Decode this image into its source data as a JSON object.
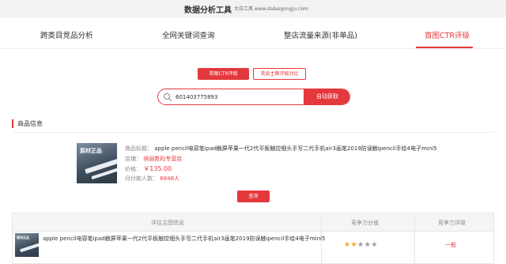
{
  "topbar": {
    "title": "数据分析工具",
    "brand": "大白工具 www.dabaigongju.com"
  },
  "nav": {
    "tabs": [
      {
        "label": "跨类目竞品分析",
        "active": false
      },
      {
        "label": "全网关键词查询",
        "active": false
      },
      {
        "label": "整店流量来源(非单品)",
        "active": false
      },
      {
        "label": "首图CTR评级",
        "active": true
      }
    ]
  },
  "mode_buttons": {
    "primary": "首图CTR评级",
    "secondary": "竞品主图评级对比"
  },
  "search": {
    "value": "601403775893",
    "button": "自动获取"
  },
  "section": {
    "title": "商品信息"
  },
  "product": {
    "thumb_text": "原材正品",
    "title_label": "商品标题：",
    "title": "apple pencil电容笔ipad触屏苹果一代2代平板触控细头手写二代手机air3画笔2019防误触ipencil手绘4电子mini5",
    "shop_label": "店铺：",
    "shop": "纳丽数码专营店",
    "price_label": "价格：",
    "price": "￥135.00",
    "buyers_label": "月付款人数：",
    "buyers": "6848人"
  },
  "query_button": "查询",
  "table": {
    "headers": [
      "评估主图信息",
      "竞争力分值",
      "竞争力评级"
    ],
    "rows": [
      {
        "title": "apple pencil电容笔ipad触屏苹果一代2代平板触控细头手写二代手机air3画笔2019防误触ipencil手绘4电子mini5",
        "stars_on": 2,
        "stars_total": 5,
        "grade": "一般"
      }
    ]
  },
  "colors": {
    "accent": "#e4393c",
    "star": "#f5a623"
  }
}
